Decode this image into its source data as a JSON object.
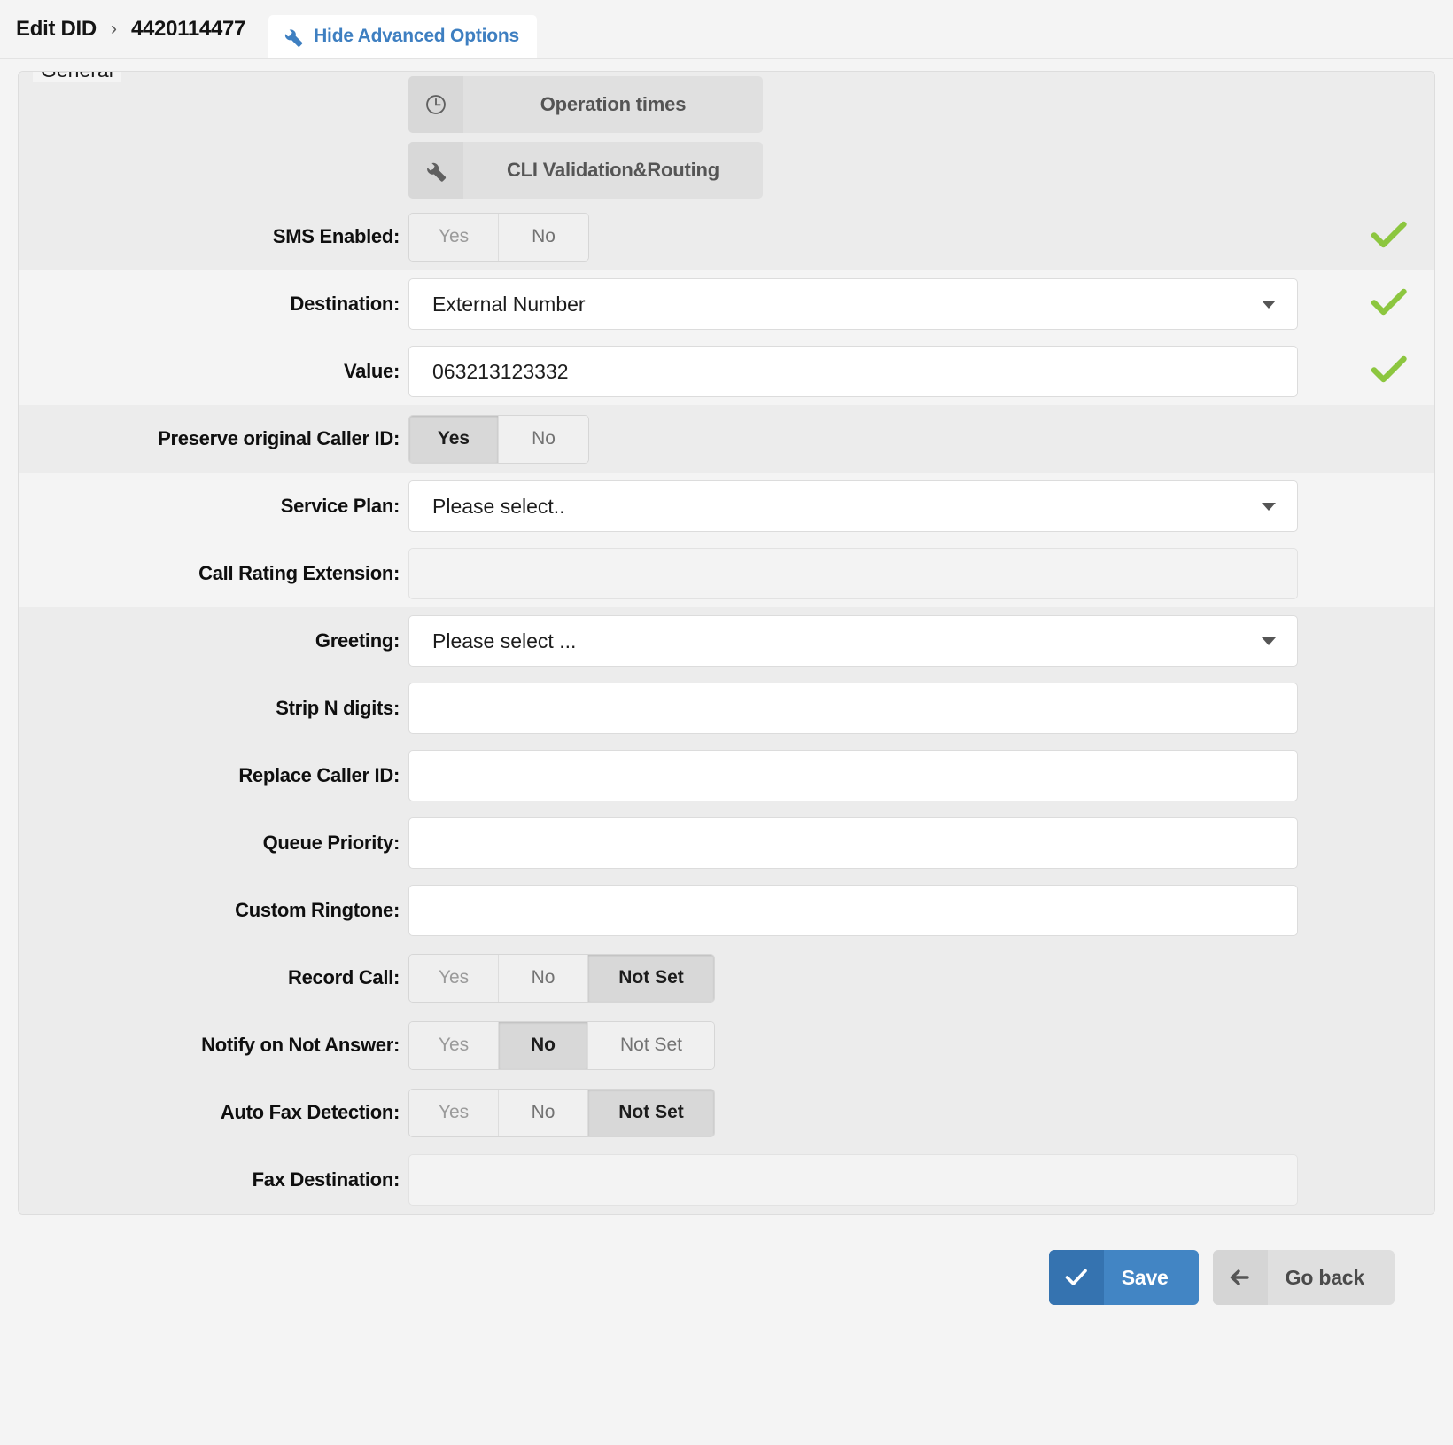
{
  "header": {
    "breadcrumb_root": "Edit DID",
    "breadcrumb_sep": "›",
    "breadcrumb_current": "4420114477",
    "advanced_toggle_label": "Hide Advanced Options",
    "advanced_toggle_icon": "wrench-icon",
    "advanced_toggle_color": "#3e7fc1"
  },
  "fieldset": {
    "legend": "General"
  },
  "nav_buttons": [
    {
      "label": "Operation times",
      "icon": "clock-icon"
    },
    {
      "label": "CLI Validation&Routing",
      "icon": "wrench-icon"
    }
  ],
  "fields": {
    "sms_enabled": {
      "label": "SMS Enabled:",
      "options": [
        "Yes",
        "No"
      ],
      "selected": "No",
      "valid": true
    },
    "destination": {
      "label": "Destination:",
      "value": "External Number",
      "valid": true
    },
    "value": {
      "label": "Value:",
      "value": "063213123332",
      "valid": true
    },
    "preserve_caller_id": {
      "label": "Preserve original Caller ID:",
      "options": [
        "Yes",
        "No"
      ],
      "selected": "Yes"
    },
    "service_plan": {
      "label": "Service Plan:",
      "value": "Please select.."
    },
    "call_rating_extension": {
      "label": "Call Rating Extension:",
      "value": ""
    },
    "greeting": {
      "label": "Greeting:",
      "value": "Please select ..."
    },
    "strip_n_digits": {
      "label": "Strip N digits:",
      "value": ""
    },
    "replace_caller_id": {
      "label": "Replace Caller ID:",
      "value": ""
    },
    "queue_priority": {
      "label": "Queue Priority:",
      "value": ""
    },
    "custom_ringtone": {
      "label": "Custom Ringtone:",
      "value": ""
    },
    "record_call": {
      "label": "Record Call:",
      "options": [
        "Yes",
        "No",
        "Not Set"
      ],
      "selected": "Not Set"
    },
    "notify_on_not_answer": {
      "label": "Notify on Not Answer:",
      "options": [
        "Yes",
        "No",
        "Not Set"
      ],
      "selected": "No"
    },
    "auto_fax_detection": {
      "label": "Auto Fax Detection:",
      "options": [
        "Yes",
        "No",
        "Not Set"
      ],
      "selected": "Not Set"
    },
    "fax_destination": {
      "label": "Fax Destination:",
      "value": ""
    }
  },
  "footer": {
    "save_label": "Save",
    "save_icon": "check-icon",
    "back_label": "Go back",
    "back_icon": "arrow-left-icon"
  },
  "colors": {
    "accent_blue": "#4285c4",
    "valid_green": "#8cc63f",
    "row_dark": "#ececec",
    "row_light": "#f4f4f4"
  }
}
